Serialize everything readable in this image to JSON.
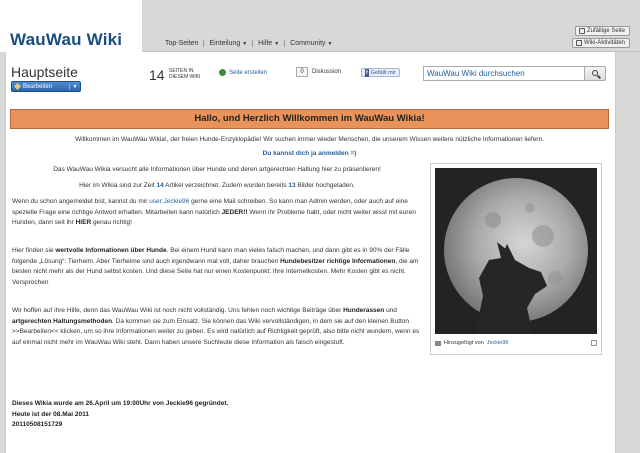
{
  "wiki": {
    "name": "WauWau Wiki"
  },
  "nav": {
    "items": [
      "Top-Seiten",
      "Einteilung",
      "Hilfe",
      "Community"
    ]
  },
  "quick": {
    "random": "Zufällige Seite",
    "activity": "Wiki-Aktivitäten"
  },
  "header": {
    "title": "Hauptseite",
    "edit_label": "Bearbeiten",
    "article_count": "14",
    "article_count_label": "SEITEN IN DIESEM WIKI",
    "create_page": "Seite erstellen",
    "discussion_count": "0",
    "discussion_label": "Diskussion",
    "fb_like": "Gefällt mir",
    "fb_icon_letter": "f",
    "search_placeholder": "WauWau Wiki durchsuchen"
  },
  "main": {
    "banner": "Hallo, und Herzlich Willkommen im WauWau Wikia!",
    "intro": "Willkommen im WauWau Wikia!, der freien Hunde-Enzyklopädie! Wir suchen immer wieder Menschen, die unserem Wissen weitere nützliche Informationen liefern.",
    "login": "Du kannst dich ja anmelden =)",
    "p1": "Das WauWau Wikia versucht alle Informationen über Hunde und deren artgerechten Haltung hier zu präsentieren!",
    "p2_a": "Hier im Wikia sind zur Zeit ",
    "p2_articles": "14",
    "p2_b": " Artikel verzeichnet. Zudem wurden bereits ",
    "p2_images": "13",
    "p2_c": " Bilder hochgeladen.",
    "p3_a": "Wenn du schon angemeldet bist, kannst du mir ",
    "p3_user": "user:Jeckie96",
    "p3_b": " gerne eine Mail schreiben. So kann man Admin werden, oder auch auf eine spezielle Frage eine richtige Antwort erhalten. Mitarbeiten kann natürlich ",
    "p3_jeder": "JEDER!!",
    "p3_c": " Wenn ihr Probleme habt, oder nicht weiter wisst mit euren Hunden, dann seit ihr ",
    "p3_hier": "HIER",
    "p3_d": " genau richtig!",
    "p4_a": "Hier finden sie ",
    "p4_b1": "wertvolle Informationen über Hunde",
    "p4_b": ". Bei einem Hund kann man vieles falsch machen, und dann gibt es in 90% der Fälle folgende „Lösung“: Tierheim. Aber Tierheime sind auch irgendwann mal voll, daher brauchen ",
    "p4_b2": "Hundebesitzer richtige Informationen",
    "p4_c": ", die am besten nicht mehr als der Hund selbst kosten. Und diese Seite hat nur einen Kostenpunkt: Ihre Internetkosten. Mehr Kosten gibt es nicht. Versprochen",
    "p5_a": "Wir hoffen auf ihre Hilfe, denn das WauWau Wiki ist noch nicht vollständig. Uns fehlen noch wichtige Beiträge über ",
    "p5_b1": "Hunderassen",
    "p5_and": " und ",
    "p5_b2": "artgerechten Haltungsmethoden",
    "p5_b": ". Da kommen sie zum Einsatz. Sie können das Wiki vervollständigen, in dem sie auf den kleinen Button >>Bearbeiten<< klicken, um so ihre Informationen weiter zu geben. Es wird natürlich auf Richtigkeit geprüft, also bitte nicht wundern, wenn es auf einmal nicht mehr im WauWau Wiki steht. Dann haben unsere Suchleute diese Information als falsch eingestuft.",
    "footer1": "Dieses Wikia wurde am 26.April um 19:00Uhr von Jeckie96 gegründet.",
    "footer2": "Heute ist der 08.Mai 2011",
    "footer3": "20110508151729"
  },
  "image": {
    "caption_prefix": "Hinzugefügt von ",
    "caption_user": "Jeckie96"
  }
}
